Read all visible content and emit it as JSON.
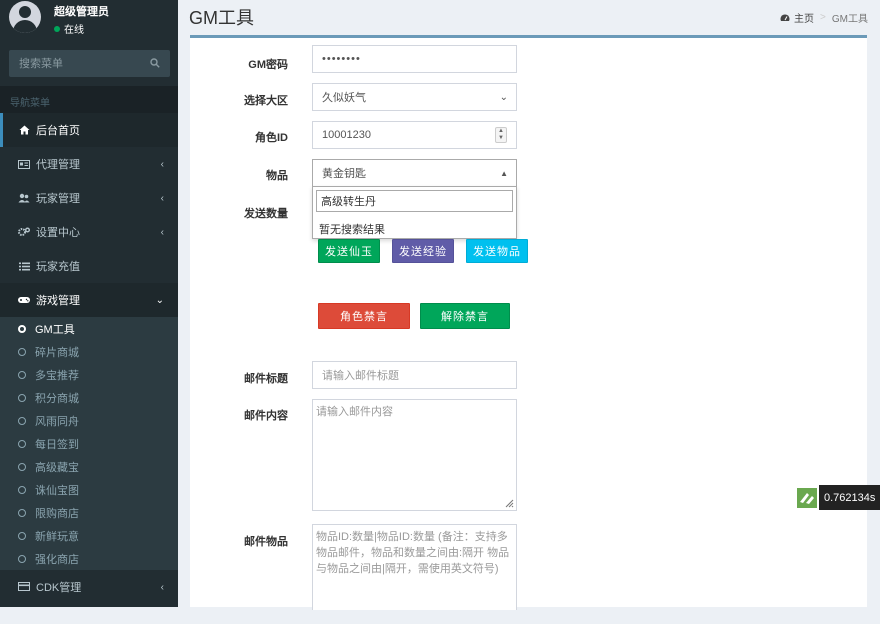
{
  "user": {
    "name": "超级管理员",
    "status": "在线"
  },
  "sidebar": {
    "search_placeholder": "搜索菜单",
    "nav_header": "导航菜单",
    "items": [
      {
        "label": "后台首页",
        "icon": "home-icon"
      },
      {
        "label": "代理管理",
        "icon": "id-card-icon"
      },
      {
        "label": "玩家管理",
        "icon": "users-icon"
      },
      {
        "label": "设置中心",
        "icon": "gears-icon"
      },
      {
        "label": "玩家充值",
        "icon": "list-icon"
      },
      {
        "label": "游戏管理",
        "icon": "gamepad-icon"
      },
      {
        "label": "CDK管理",
        "icon": "credit-card-icon"
      }
    ],
    "game_submenu": [
      "GM工具",
      "碎片商城",
      "多宝推荐",
      "积分商城",
      "风雨同舟",
      "每日签到",
      "高级藏宝",
      "诛仙宝图",
      "限购商店",
      "新鲜玩意",
      "强化商店"
    ]
  },
  "header": {
    "title": "GM工具",
    "breadcrumb_home": "主页",
    "breadcrumb_current": "GM工具"
  },
  "form": {
    "password_label": "GM密码",
    "password_value": "••••••••",
    "server_label": "选择大区",
    "server_value": "久似妖气",
    "role_id_label": "角色ID",
    "role_id_value": "10001230",
    "item_label": "物品",
    "item_value": "黄金钥匙",
    "item_search_text": "高级转生丹",
    "item_no_results": "暂无搜索结果",
    "send_count_label": "发送数量",
    "btn_send_jade": "发送仙玉",
    "btn_send_exp": "发送经验",
    "btn_send_item": "发送物品",
    "btn_ban_role": "角色禁言",
    "btn_unban": "解除禁言",
    "mail_title_label": "邮件标题",
    "mail_title_placeholder": "请输入邮件标题",
    "mail_content_label": "邮件内容",
    "mail_content_placeholder": "请输入邮件内容",
    "mail_items_label": "邮件物品",
    "mail_items_placeholder": "物品ID:数量|物品ID:数量 (备注：支持多物品邮件，物品和数量之间由:隔开 物品与物品之间由|隔开，需使用英文符号)"
  },
  "timer": {
    "value": "0.762134s"
  },
  "colors": {
    "sidebar_bg": "#222d32",
    "accent": "#3c8dbc",
    "success": "#00a65a",
    "purple": "#605ca8",
    "info": "#00c0ef",
    "danger": "#dd4b39"
  }
}
